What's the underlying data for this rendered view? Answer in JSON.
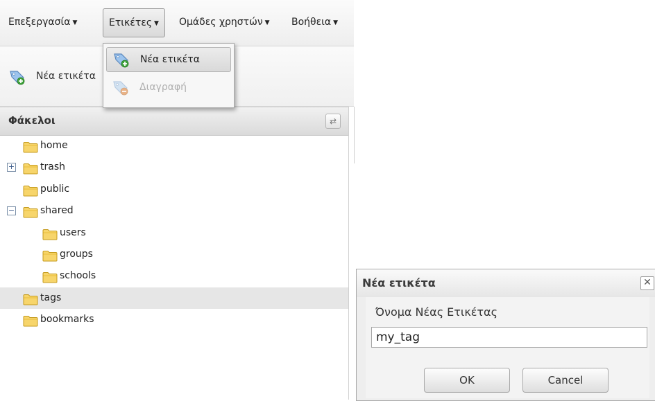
{
  "menubar": {
    "items": [
      {
        "label": "Επεξεργασία"
      },
      {
        "label": "Ετικέτες"
      },
      {
        "label": "Ομάδες χρηστών"
      },
      {
        "label": "Βοήθεια"
      }
    ]
  },
  "dropdown": {
    "items": [
      {
        "label": "Νέα ετικέτα",
        "icon": "tag-add-icon",
        "state": "highlighted"
      },
      {
        "label": "Διαγραφή",
        "icon": "tag-delete-icon",
        "state": "disabled"
      }
    ]
  },
  "toolbar": {
    "new_tag_label": "Νέα ετικέτα",
    "new_tag_icon": "tag-add-icon"
  },
  "folders_panel": {
    "title": "Φάκελοι",
    "refresh_icon": "refresh-icon",
    "tree": [
      {
        "label": "home",
        "level": 0,
        "expander": "none"
      },
      {
        "label": "trash",
        "level": 0,
        "expander": "collapsed"
      },
      {
        "label": "public",
        "level": 0,
        "expander": "none"
      },
      {
        "label": "shared",
        "level": 0,
        "expander": "expanded"
      },
      {
        "label": "users",
        "level": 1,
        "expander": "none"
      },
      {
        "label": "groups",
        "level": 1,
        "expander": "none"
      },
      {
        "label": "schools",
        "level": 1,
        "expander": "none"
      },
      {
        "label": "tags",
        "level": 0,
        "expander": "none",
        "selected": true
      },
      {
        "label": "bookmarks",
        "level": 0,
        "expander": "none"
      }
    ]
  },
  "dialog": {
    "title": "Νέα ετικέτα",
    "close_icon": "close-icon",
    "field_label": "Όνομα Νέας Ετικέτας",
    "field_value": "my_tag",
    "ok_label": "OK",
    "cancel_label": "Cancel"
  },
  "colors": {
    "folder_fill": "#f7d56b",
    "selected_row": "#e6e6e6",
    "tag_icon": "#6e9fd6",
    "tag_add_badge": "#3ea33a",
    "tag_delete_badge": "#e0863e"
  }
}
